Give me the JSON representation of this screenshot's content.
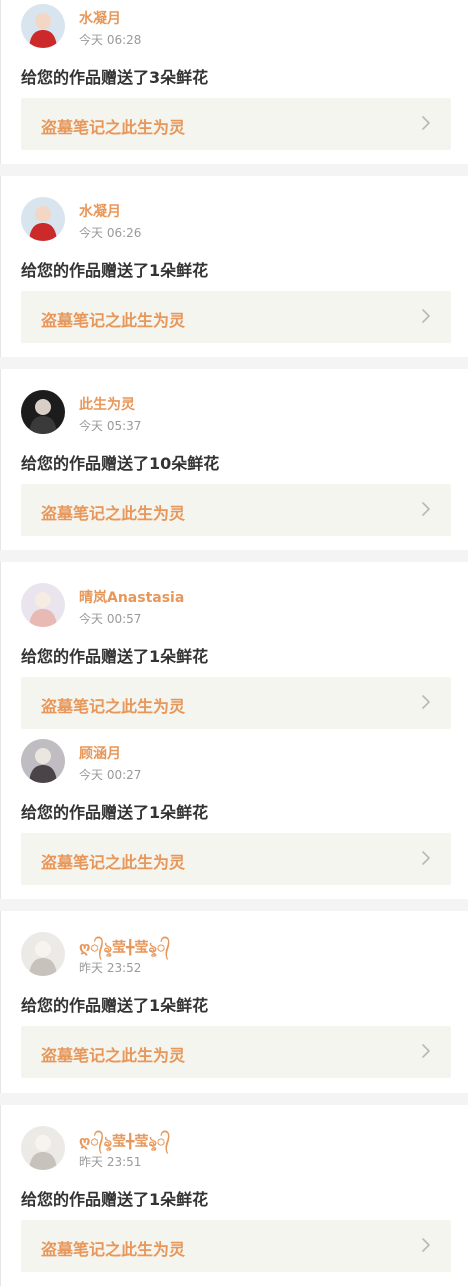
{
  "notifications": [
    {
      "user": "水凝月",
      "time": "今天 06:28",
      "message": "给您的作品赠送了3朵鲜花",
      "book": "盗墓笔记之此生为灵",
      "avatar": "avatar-red-dress-icon",
      "avatar_colors": [
        "#d8e4ee",
        "#cc2a2a",
        "#f3d6c4"
      ]
    },
    {
      "user": "水凝月",
      "time": "今天 06:26",
      "message": "给您的作品赠送了1朵鲜花",
      "book": "盗墓笔记之此生为灵",
      "avatar": "avatar-red-dress-icon",
      "avatar_colors": [
        "#d8e4ee",
        "#cc2a2a",
        "#f3d6c4"
      ]
    },
    {
      "user": "此生为灵",
      "time": "今天 05:37",
      "message": "给您的作品赠送了10朵鲜花",
      "book": "盗墓笔记之此生为灵",
      "avatar": "avatar-dark-portrait-icon",
      "avatar_colors": [
        "#1c1c1c",
        "#3a3a3a",
        "#d9cfc6"
      ]
    },
    {
      "user": "晴岚Anastasia",
      "time": "今天 00:57",
      "message": "给您的作品赠送了1朵鲜花",
      "book": "盗墓笔记之此生为灵",
      "avatar": "avatar-pastel-girl-icon",
      "avatar_colors": [
        "#e9e4ee",
        "#e9b9b4",
        "#f6ece2"
      ]
    },
    {
      "user": "顾涵月",
      "time": "今天 00:27",
      "message": "给您的作品赠送了1朵鲜花",
      "book": "盗墓笔记之此生为灵",
      "avatar": "avatar-gray-portrait-icon",
      "avatar_colors": [
        "#bfbcc2",
        "#4a4448",
        "#ece6e0"
      ]
    },
    {
      "user": "ღ᭄ৡ莹╋莹ৡ᭄",
      "time": "昨天 23:52",
      "message": "给您的作品赠送了1朵鲜花",
      "book": "盗墓笔记之此生为灵",
      "avatar": "avatar-light-sketch-icon",
      "avatar_colors": [
        "#eceae6",
        "#c8c2bc",
        "#f7f4f0"
      ]
    },
    {
      "user": "ღ᭄ৡ莹╋莹ৡ᭄",
      "time": "昨天 23:51",
      "message": "给您的作品赠送了1朵鲜花",
      "book": "盗墓笔记之此生为灵",
      "avatar": "avatar-light-sketch-icon",
      "avatar_colors": [
        "#eceae6",
        "#c8c2bc",
        "#f7f4f0"
      ]
    }
  ]
}
